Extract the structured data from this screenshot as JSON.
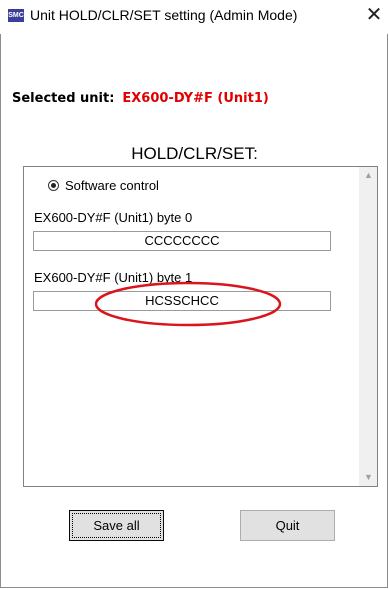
{
  "window": {
    "title": "Unit HOLD/CLR/SET setting (Admin Mode)",
    "icon_text": "SMC",
    "close_glyph": "✕"
  },
  "selected": {
    "label": "Selected unit:",
    "value": "EX600-DY#F (Unit1)",
    "value_color": "#e00000"
  },
  "panel": {
    "title": "HOLD/CLR/SET:",
    "radio_label": "Software control",
    "bytes": [
      {
        "label": "EX600-DY#F (Unit1)  byte 0",
        "value": "CCCCCCCC"
      },
      {
        "label": "EX600-DY#F (Unit1)  byte 1",
        "value": "HCSSCHCC"
      }
    ],
    "annotation_color": "#d9161e"
  },
  "buttons": {
    "save_all": "Save all",
    "quit": "Quit"
  }
}
